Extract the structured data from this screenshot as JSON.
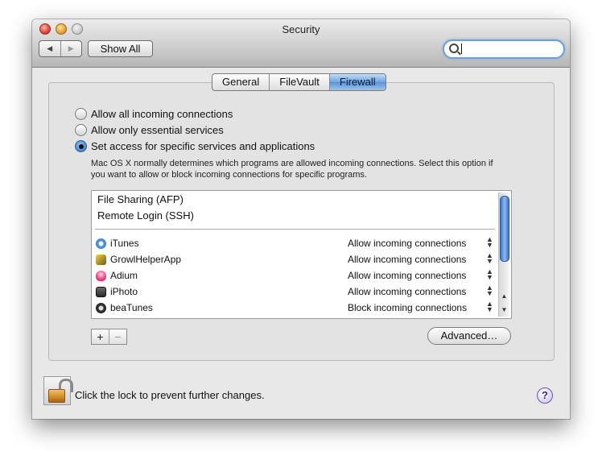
{
  "window": {
    "title": "Security"
  },
  "toolbar": {
    "back_glyph": "◀",
    "forward_glyph": "▶",
    "show_all_label": "Show All",
    "search_value": ""
  },
  "tabs": [
    {
      "label": "General",
      "active": false
    },
    {
      "label": "FileVault",
      "active": false
    },
    {
      "label": "Firewall",
      "active": true
    }
  ],
  "firewall": {
    "options": [
      {
        "label": "Allow all incoming connections",
        "selected": false
      },
      {
        "label": "Allow only essential services",
        "selected": false
      },
      {
        "label": "Set access for specific services and applications",
        "selected": true
      }
    ],
    "description": "Mac OS X normally determines which programs are allowed incoming connections. Select this option if you want to allow or block incoming connections for specific programs.",
    "services": [
      "File Sharing (AFP)",
      "Remote Login (SSH)"
    ],
    "apps": [
      {
        "name": "iTunes",
        "setting": "Allow incoming connections",
        "icon": "itunes-icon"
      },
      {
        "name": "GrowlHelperApp",
        "setting": "Allow incoming connections",
        "icon": "growl-icon"
      },
      {
        "name": "Adium",
        "setting": "Allow incoming connections",
        "icon": "adium-icon"
      },
      {
        "name": "iPhoto",
        "setting": "Allow incoming connections",
        "icon": "iphoto-icon"
      },
      {
        "name": "beaTunes",
        "setting": "Block incoming connections",
        "icon": "beatunes-icon"
      }
    ],
    "add_label": "+",
    "remove_label": "−",
    "advanced_label": "Advanced…"
  },
  "footer": {
    "lock_text": "Click the lock to prevent further changes.",
    "help_label": "?"
  },
  "colors": {
    "accent": "#5b92d6",
    "selected_tab": "#6ea4e2"
  }
}
